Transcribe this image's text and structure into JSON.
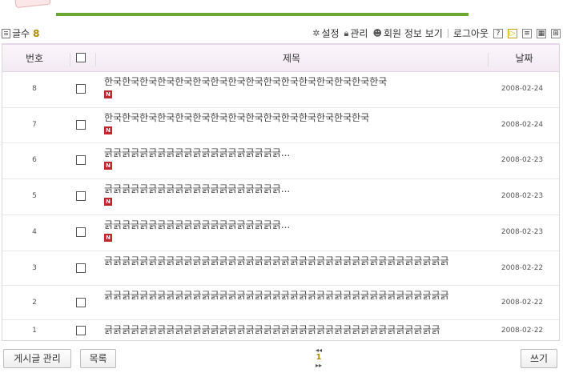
{
  "toolbar": {
    "count_label": "글수",
    "count_value": "8",
    "settings_label": "설정",
    "manage_label": "관리",
    "member_info_label": "회원 정보 보기",
    "logout_label": "로그아웃",
    "help_label": "?"
  },
  "table": {
    "headers": {
      "number": "번호",
      "subject": "제목",
      "date": "날짜"
    },
    "rows": [
      {
        "number": "8",
        "subject": "한국한국한국한국한국한국한국한국한국한국한국한국한국한국한국한국",
        "is_new": true,
        "date": "2008-02-24"
      },
      {
        "number": "7",
        "subject": "한국한국한국한국한국한국한국한국한국한국한국한국한국한국한국",
        "is_new": true,
        "date": "2008-02-24"
      },
      {
        "number": "6",
        "subject": "긁긁긁긁긁긁긁긁긁긁긁긁긁긁긁긁긁긁긁긁...",
        "is_new": true,
        "date": "2008-02-23"
      },
      {
        "number": "5",
        "subject": "긁긁긁긁긁긁긁긁긁긁긁긁긁긁긁긁긁긁긁긁...",
        "is_new": true,
        "date": "2008-02-23"
      },
      {
        "number": "4",
        "subject": "긁긁긁긁긁긁긁긁긁긁긁긁긁긁긁긁긁긁긁긁...",
        "is_new": true,
        "date": "2008-02-23"
      },
      {
        "number": "3",
        "subject": "긁긁긁긁긁긁긁긁긁긁긁긁긁긁긁긁긁긁긁긁긁긁긁긁긁긁긁긁긁긁긁긁긁긁긁긁긁긁긁",
        "is_new": false,
        "date": "2008-02-22"
      },
      {
        "number": "2",
        "subject": "긁긁긁긁긁긁긁긁긁긁긁긁긁긁긁긁긁긁긁긁긁긁긁긁긁긁긁긁긁긁긁긁긁긁긁긁긁긁긁",
        "is_new": false,
        "date": "2008-02-22"
      },
      {
        "number": "1",
        "subject": "긁긁긁긁긁긁긁긁긁긁긁긁긁긁긁긁긁긁긁긁긁긁긁긁긁긁긁긁긁긁긁긁긁긁긁긁긁긁",
        "is_new": false,
        "date": "2008-02-22"
      }
    ],
    "new_badge": "N"
  },
  "bottom": {
    "manage_posts_label": "게시글 관리",
    "list_label": "목록",
    "current_page": "1",
    "write_label": "쓰기"
  },
  "colors": {
    "accent_green": "#6aa832",
    "new_badge": "#c0282d",
    "count_highlight": "#b08a00"
  },
  "icons": [
    "document-icon",
    "gear-icon",
    "lock-icon",
    "person-icon",
    "help-icon",
    "play-icon",
    "list-view-icon",
    "grid-view-icon",
    "gallery-view-icon",
    "new-badge-icon"
  ]
}
